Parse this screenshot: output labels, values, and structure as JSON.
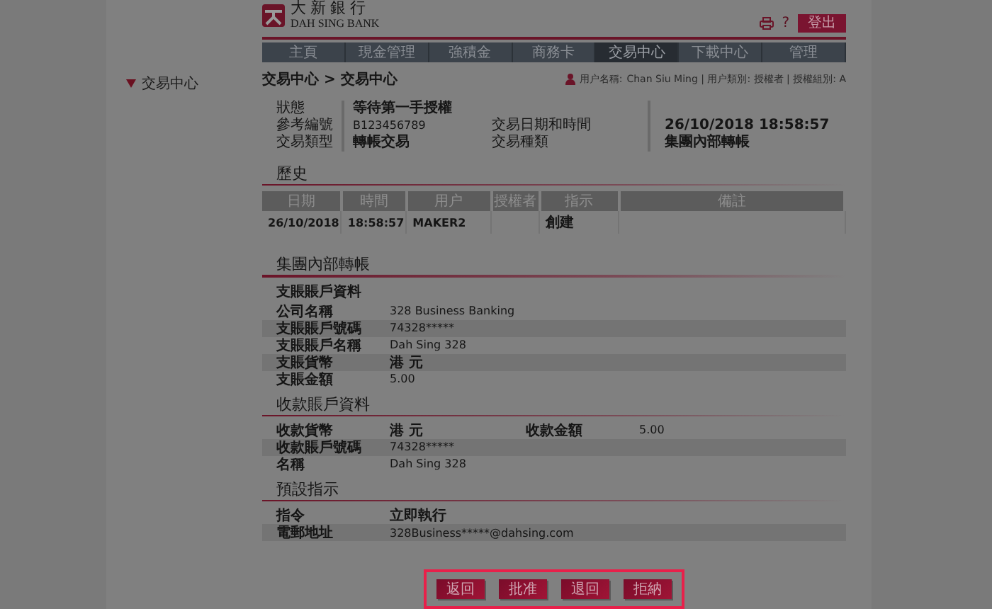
{
  "header": {
    "logo_cn": "大新銀行",
    "logo_en": "DAH SING BANK",
    "help": "?",
    "logout": "登出"
  },
  "nav": [
    {
      "label": "主頁",
      "selected": false
    },
    {
      "label": "現金管理",
      "selected": false
    },
    {
      "label": "強積金",
      "selected": false
    },
    {
      "label": "商務卡",
      "selected": false
    },
    {
      "label": "交易中心",
      "selected": true
    },
    {
      "label": "下載中心",
      "selected": false
    },
    {
      "label": "管理",
      "selected": false
    }
  ],
  "sidebar": [
    {
      "label": "交易中心",
      "expanded": true
    }
  ],
  "breadcrumb": "交易中心 > 交易中心",
  "user_info": {
    "label": "用户名稱:",
    "value": "Chan Siu Ming | 用户類別: 授權者 | 授權組別: A"
  },
  "summary": [
    {
      "label": "狀態",
      "value": "等待第一手授權"
    },
    {
      "label": "參考編號",
      "value": "B123456789",
      "label2": "交易日期和時間",
      "value2": "26/10/2018 18:58:57"
    },
    {
      "label": "交易類型",
      "value": "轉帳交易",
      "label2": "交易種類",
      "value2": "集團內部轉帳"
    }
  ],
  "history": {
    "title": "歷史",
    "columns": [
      "日期",
      "時間",
      "用户",
      "授權者",
      "指示",
      "備註"
    ],
    "rows": [
      [
        "26/10/2018",
        "18:58:57",
        "MAKER2",
        "",
        "創建",
        ""
      ]
    ]
  },
  "transfer_title": "集團內部轉帳",
  "sections": [
    {
      "title": "支賬賬戶資料",
      "rows": [
        {
          "label": "公司名稱",
          "value": "328 Business Banking"
        },
        {
          "label": "支賬賬戶號碼",
          "value": "74328*****"
        },
        {
          "label": "支賬賬戶名稱",
          "value": "Dah Sing 328"
        },
        {
          "label": "支賬貨幣",
          "value": "港 元"
        },
        {
          "label": "支賬金額",
          "value": "5.00"
        }
      ]
    },
    {
      "title": "收款賬戶資料",
      "rows": [
        {
          "label": "收款貨幣",
          "value": "港 元",
          "label2": "收款金額",
          "value2": "5.00"
        },
        {
          "label": "收款賬戶號碼",
          "value": "74328*****"
        },
        {
          "label": "名稱",
          "value": "Dah Sing 328"
        }
      ]
    },
    {
      "title": "預設指示",
      "rows": [
        {
          "label": "指令",
          "value": "立即執行"
        },
        {
          "label": "電郵地址",
          "value": "328Business*****@dahsing.com"
        }
      ]
    }
  ],
  "buttons": [
    "返回",
    "批准",
    "退回",
    "拒納"
  ]
}
